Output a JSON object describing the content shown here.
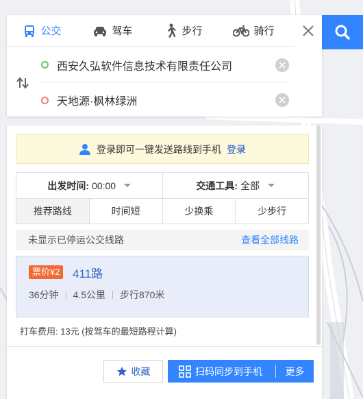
{
  "transport_modes": [
    {
      "label": "公交",
      "icon": "bus-icon",
      "active": true
    },
    {
      "label": "驾车",
      "icon": "car-icon",
      "active": false
    },
    {
      "label": "步行",
      "icon": "walk-icon",
      "active": false
    },
    {
      "label": "骑行",
      "icon": "bike-icon",
      "active": false
    }
  ],
  "route": {
    "origin": "西安久弘软件信息技术有限责任公司",
    "destination": "天地源·枫林绿洲"
  },
  "login_prompt": {
    "text": "登录即可一键发送路线到手机",
    "link": "登录"
  },
  "filters": {
    "departure_label": "出发时间:",
    "departure_value": "00:00",
    "vehicle_label": "交通工具:",
    "vehicle_value": "全部"
  },
  "sort_tabs": [
    "推荐路线",
    "时间短",
    "少换乘",
    "少步行"
  ],
  "notice": {
    "text": "未显示已停运公交线路",
    "link": "查看全部线路"
  },
  "result": {
    "fare_badge": "票价¥2",
    "line": "411路",
    "duration": "36分钟",
    "distance": "4.5公里",
    "walk": "步行870米"
  },
  "taxi_fare": "打车费用: 13元 (按驾车的最短路程计算)",
  "actions": {
    "favorite": "收藏",
    "sync": "扫码同步到手机",
    "more": "更多"
  },
  "colors": {
    "accent": "#3385ff",
    "fare_badge": "#f26a34",
    "start_dot": "#6ac46a",
    "end_dot": "#f27a7a"
  }
}
